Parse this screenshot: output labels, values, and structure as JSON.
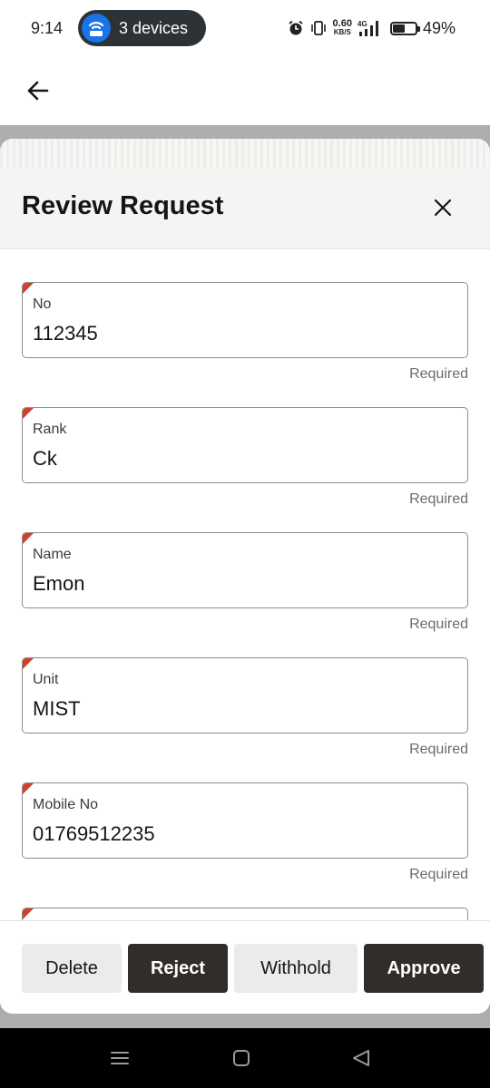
{
  "status_bar": {
    "time": "9:14",
    "hotspot_label": "3 devices",
    "net_speed": "0.60",
    "net_unit": "KB/S",
    "net_type": "4G",
    "battery_percent": "49%",
    "battery_level": 0.49
  },
  "sheet": {
    "title": "Review Request"
  },
  "fields": [
    {
      "label": "No",
      "value": "112345",
      "hint": "Required"
    },
    {
      "label": "Rank",
      "value": "Ck",
      "hint": "Required"
    },
    {
      "label": "Name",
      "value": "Emon",
      "hint": "Required"
    },
    {
      "label": "Unit",
      "value": "MIST",
      "hint": "Required"
    },
    {
      "label": "Mobile No",
      "value": "01769512235",
      "hint": "Required"
    }
  ],
  "actions": {
    "delete": "Delete",
    "reject": "Reject",
    "withhold": "Withhold",
    "approve": "Approve"
  },
  "colors": {
    "accent_dark": "#312d2a",
    "required_marker": "#d0412c",
    "hotspot_blue": "#1a73e8"
  }
}
